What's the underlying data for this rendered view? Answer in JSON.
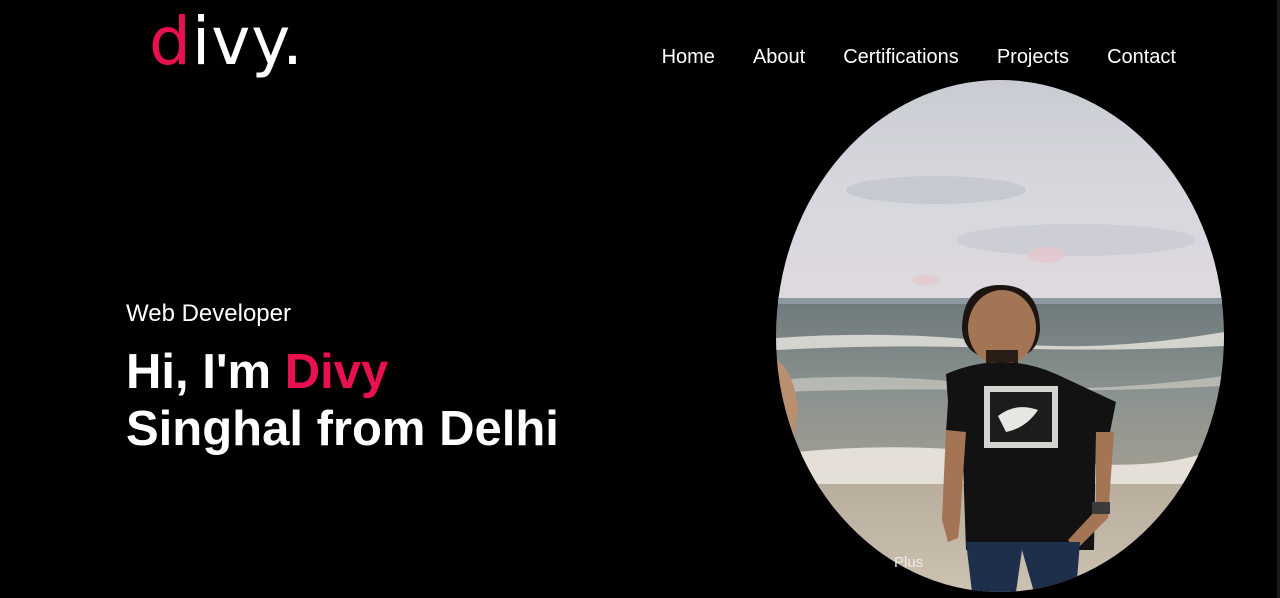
{
  "brand": {
    "logo_accent": "d",
    "logo_rest": "ivy."
  },
  "nav": {
    "items": [
      "Home",
      "About",
      "Certifications",
      "Projects",
      "Contact"
    ]
  },
  "hero": {
    "subtitle": "Web Developer",
    "greeting": "Hi, I'm ",
    "name_highlight": "Divy",
    "line2": "Singhal from Delhi"
  },
  "photo": {
    "watermark": "Plus"
  },
  "colors": {
    "accent": "#e8104f",
    "background": "#000000",
    "text": "#ffffff"
  }
}
